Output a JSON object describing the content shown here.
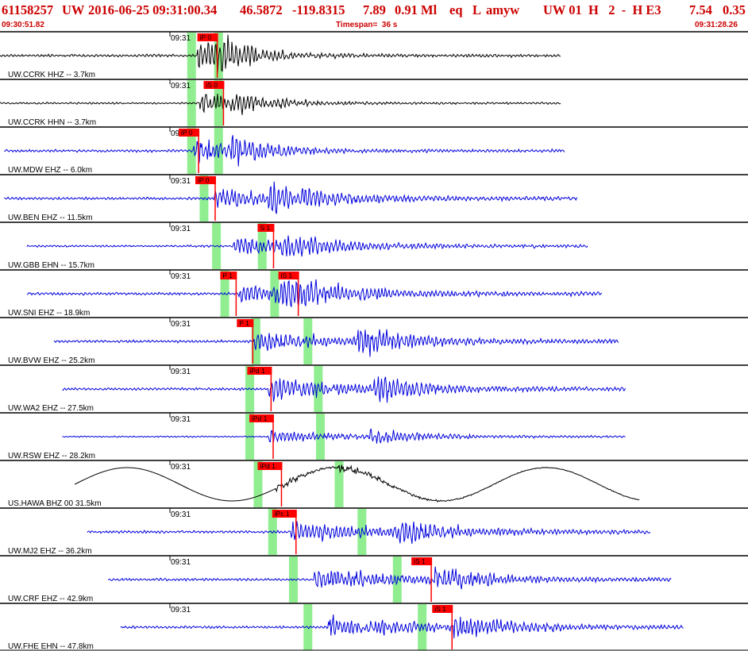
{
  "header": {
    "event_id": "61158257",
    "network": "UW",
    "datetime": "2016-06-25 09:31:00.34",
    "lat": "46.5872",
    "lon": "-119.8315",
    "depth": "7.89",
    "magnitude": "0.91 Ml",
    "etype": "eq",
    "locality": "L",
    "analyst": "amyw",
    "source_info": "UW 01  H   2  -  H E3",
    "extra1": "7.54",
    "extra2": "0.35",
    "start_time": "09:30:51.82",
    "timespan": "Timespan=  36 s",
    "end_time": "09:31:28.26"
  },
  "chart_data": {
    "type": "line",
    "title": "",
    "xlabel": "",
    "ylabel": "",
    "time_window_s": 36,
    "minute_tick_label": "09:31",
    "colors": {
      "vertical_trace": "#0000dd",
      "broadband_trace": "#000000",
      "pick": "#ff0000",
      "predicted_window": "#90ee90",
      "header": "#cc0000"
    },
    "traces": [
      {
        "label": "UW.CCRK HHZ -- 3.7km",
        "color": "#000000",
        "start_s": 0.0,
        "end_s": 27.0,
        "amplitude": 0.55,
        "p_arrival_s": 9.5,
        "s_arrival_s": 10.3,
        "envelope": "impulsive",
        "picks": [
          {
            "text": "iP 0",
            "time_s": 9.5
          }
        ],
        "green_windows_s": [
          9.2,
          10.5
        ]
      },
      {
        "label": "UW.CCRK HHN -- 3.7km",
        "color": "#000000",
        "start_s": 0.0,
        "end_s": 27.0,
        "amplitude": 0.4,
        "p_arrival_s": 9.6,
        "s_arrival_s": 11.1,
        "envelope": "impulsive",
        "picks": [
          {
            "text": "iS 0",
            "time_s": 9.8
          }
        ],
        "green_windows_s": [
          9.2,
          10.5
        ]
      },
      {
        "label": "UW.MDW EHZ -- 6.0km",
        "color": "#0000dd",
        "start_s": 0.2,
        "end_s": 27.2,
        "amplitude": 0.55,
        "p_arrival_s": 9.3,
        "s_arrival_s": 11.1,
        "envelope": "impulsive",
        "picks": [
          {
            "text": "iP 0",
            "time_s": 8.6
          }
        ],
        "green_windows_s": [
          9.2,
          10.5
        ]
      },
      {
        "label": "UW.BEN EHZ -- 11.5km",
        "color": "#0000dd",
        "start_s": 0.2,
        "end_s": 27.8,
        "amplitude": 0.55,
        "p_arrival_s": 10.3,
        "s_arrival_s": 12.9,
        "envelope": "emergent",
        "picks": [
          {
            "text": "iP 0",
            "time_s": 9.4
          }
        ],
        "green_windows_s": [
          9.8
        ]
      },
      {
        "label": "UW.GBB EHN -- 15.7km",
        "color": "#0000dd",
        "start_s": 1.3,
        "end_s": 28.3,
        "amplitude": 0.45,
        "p_arrival_s": 11.2,
        "s_arrival_s": 13.5,
        "envelope": "emergent",
        "picks": [
          {
            "text": "S 1",
            "time_s": 12.4
          }
        ],
        "green_windows_s": [
          10.4,
          12.6
        ]
      },
      {
        "label": "UW.SNI EHZ -- 18.9km",
        "color": "#0000dd",
        "start_s": 1.3,
        "end_s": 29.0,
        "amplitude": 0.6,
        "p_arrival_s": 11.5,
        "s_arrival_s": 13.4,
        "envelope": "emergent",
        "picks": [
          {
            "text": "P 1",
            "time_s": 10.6
          },
          {
            "text": "iS 1",
            "time_s": 13.4
          }
        ],
        "green_windows_s": [
          10.8,
          13.2
        ]
      },
      {
        "label": "UW.BVW EHZ -- 25.2km",
        "color": "#0000dd",
        "start_s": 2.6,
        "end_s": 29.8,
        "amplitude": 0.55,
        "p_arrival_s": 12.2,
        "s_arrival_s": 17.2,
        "envelope": "emergent",
        "picks": [
          {
            "text": "P 1",
            "time_s": 11.4
          }
        ],
        "green_windows_s": [
          12.3,
          14.8
        ]
      },
      {
        "label": "UW.WA2 EHZ -- 27.5km",
        "color": "#0000dd",
        "start_s": 3.0,
        "end_s": 30.1,
        "amplitude": 0.55,
        "p_arrival_s": 12.9,
        "s_arrival_s": 18.0,
        "envelope": "emergent",
        "picks": [
          {
            "text": "iPd 1",
            "time_s": 11.9
          }
        ],
        "green_windows_s": [
          12.0,
          15.3
        ]
      },
      {
        "label": "UW.RSW EHZ -- 28.2km",
        "color": "#0000dd",
        "start_s": 3.0,
        "end_s": 30.1,
        "amplitude": 0.3,
        "p_arrival_s": 12.9,
        "s_arrival_s": 17.8,
        "envelope": "emergent",
        "picks": [
          {
            "text": "iPd 1",
            "time_s": 12.0
          }
        ],
        "green_windows_s": [
          12.0,
          15.4
        ]
      },
      {
        "label": "US.HAWA BHZ 00 31.5km",
        "color": "#000000",
        "start_s": 3.6,
        "end_s": 30.8,
        "amplitude": 0.55,
        "p_arrival_s": 13.3,
        "s_arrival_s": 16.3,
        "envelope": "impulsive",
        "picks": [
          {
            "text": "iPd 1",
            "time_s": 12.4
          }
        ],
        "green_windows_s": [
          12.4,
          16.3
        ]
      },
      {
        "label": "UW.MJ2 EHZ -- 36.2km",
        "color": "#0000dd",
        "start_s": 4.2,
        "end_s": 31.3,
        "amplitude": 0.55,
        "p_arrival_s": 14.0,
        "s_arrival_s": 19.0,
        "envelope": "emergent",
        "picks": [
          {
            "text": "iPc 1",
            "time_s": 13.1
          }
        ],
        "green_windows_s": [
          13.1,
          17.4
        ]
      },
      {
        "label": "UW.CRF EHZ -- 42.9km",
        "color": "#0000dd",
        "start_s": 5.2,
        "end_s": 32.3,
        "amplitude": 0.55,
        "p_arrival_s": 15.1,
        "s_arrival_s": 20.9,
        "envelope": "emergent",
        "picks": [
          {
            "text": "iS 1",
            "time_s": 19.8
          }
        ],
        "green_windows_s": [
          14.1,
          19.1
        ]
      },
      {
        "label": "UW.FHE EHN -- 47.8km",
        "color": "#0000dd",
        "start_s": 5.8,
        "end_s": 32.9,
        "amplitude": 0.55,
        "p_arrival_s": 15.8,
        "s_arrival_s": 21.8,
        "envelope": "emergent",
        "picks": [
          {
            "text": "iS 1",
            "time_s": 20.8
          }
        ],
        "green_windows_s": [
          14.8,
          20.3
        ]
      }
    ]
  }
}
